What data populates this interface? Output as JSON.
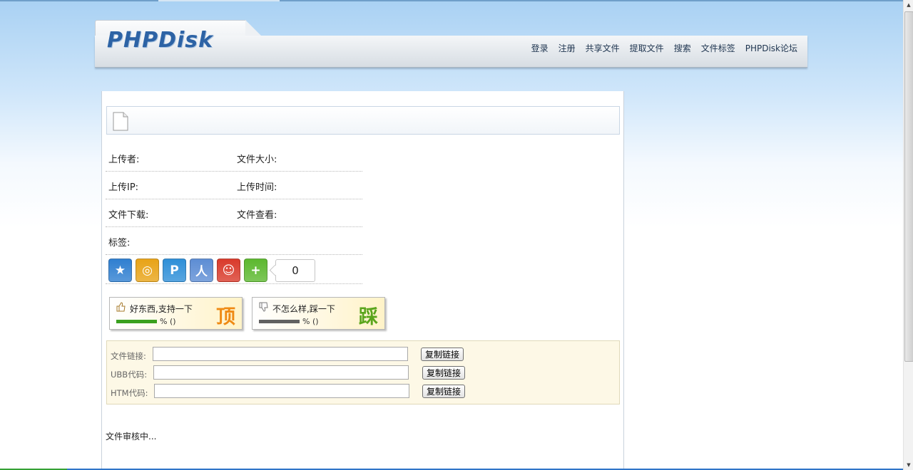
{
  "header": {
    "logo_text": "PHPDisk",
    "nav": [
      "登录",
      "注册",
      "共享文件",
      "提取文件",
      "搜索",
      "文件标签",
      "PHPDisk论坛"
    ]
  },
  "file": {
    "title": "",
    "fields": {
      "uploader": "上传者:",
      "size": "文件大小:",
      "ip": "上传IP:",
      "time": "上传时间:",
      "downloads": "文件下载:",
      "views": "文件查看:",
      "tags": "标签:"
    }
  },
  "share": {
    "icons": [
      "qzone-icon",
      "weibo-icon",
      "pengyou-icon",
      "renren-icon",
      "kaixin-icon",
      "more-share-icon"
    ],
    "colors": [
      "#2f7fd0",
      "#e8a317",
      "#2e8fd8",
      "#5d8dd4",
      "#d93a2b",
      "#5cb82f"
    ],
    "count": "0"
  },
  "vote": {
    "up_label": "好东西,支持一下",
    "up_pct": "% ()",
    "up_big": "顶",
    "up_bar_color": "#3aa01e",
    "up_big_color": "#ef8a14",
    "down_label": "不怎么样,踩一下",
    "down_pct": "% ()",
    "down_big": "踩",
    "down_bar_color": "#616161",
    "down_big_color": "#5aa51c"
  },
  "links": {
    "file_link_label": "文件链接:",
    "ubb_label": "UBB代码:",
    "htm_label": "HTM代码:",
    "file_link_value": "",
    "ubb_value": "",
    "htm_value": "",
    "copy_button": "复制链接"
  },
  "status": "文件审核中..."
}
